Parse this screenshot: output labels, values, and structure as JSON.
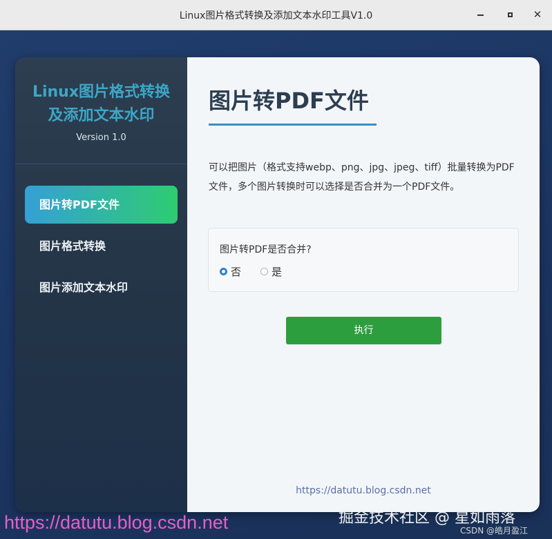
{
  "window": {
    "title": "Linux图片格式转换及添加文本水印工具V1.0",
    "controls": [
      "minimize-icon",
      "maximize-icon",
      "close-icon"
    ]
  },
  "sidebar": {
    "brand_line1": "Linux图片格式转换",
    "brand_line2": "及添加文本水印",
    "version": "Version 1.0",
    "items": [
      {
        "label": "图片转PDF文件",
        "active": true
      },
      {
        "label": "图片格式转换",
        "active": false
      },
      {
        "label": "图片添加文本水印",
        "active": false
      }
    ]
  },
  "main": {
    "title": "图片转PDF文件",
    "description": "可以把图片（格式支持webp、png、jpg、jpeg、tiff）批量转换为PDF文件，多个图片转换时可以选择是否合并为一个PDF文件。",
    "merge": {
      "label": "图片转PDF是否合并?",
      "options": [
        {
          "label": "否",
          "checked": true
        },
        {
          "label": "是",
          "checked": false
        }
      ]
    },
    "execute_button": "执行",
    "footer_link": "https://datutu.blog.csdn.net"
  },
  "overlays": {
    "left_watermark": "https://datutu.blog.csdn.net",
    "right_watermark": "掘金技术社区 @ 星如雨落",
    "csdn_watermark": "CSDN @皓月盈江"
  },
  "colors": {
    "accent_gradient_start": "#35a0d6",
    "accent_gradient_end": "#2ecc71",
    "execute_button": "#2d9e3e",
    "brand_text": "#3ea6c6",
    "title_underline": "#3b8ec2"
  }
}
